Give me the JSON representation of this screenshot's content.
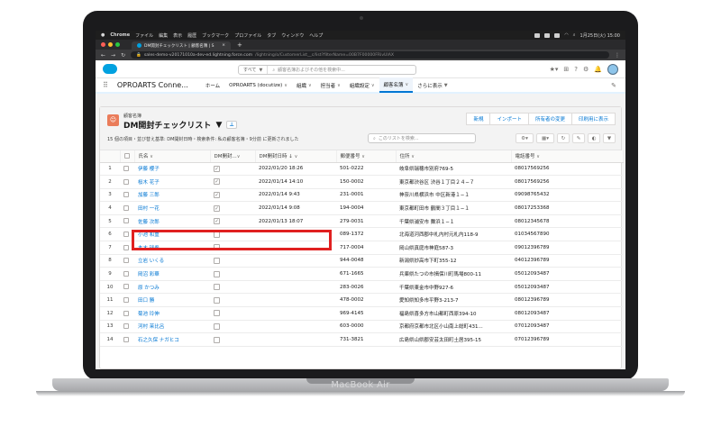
{
  "device": {
    "brand": "MacBook Air"
  },
  "mac_menu": {
    "items": [
      "Chrome",
      "ファイル",
      "編集",
      "表示",
      "履歴",
      "ブックマーク",
      "プロファイル",
      "タブ",
      "ウィンドウ",
      "ヘルプ"
    ],
    "clock": "1月25日(火) 15:00"
  },
  "browser": {
    "tab_title": "DM開封チェックリスト | 顧客名簿 | S",
    "url_host": "sales-demo-v20171010a-dev-ed.lightning.force.com",
    "url_path": "/lightning/o/CustomerList__c/list?filterName=00B7F00000FRivUIAX"
  },
  "sf_header": {
    "search_scope": "すべて",
    "search_placeholder": "顧客名簿およびその他を検索中..."
  },
  "nav": {
    "app_name": "OPROARTS Conne...",
    "items": [
      {
        "label": "ホーム"
      },
      {
        "label": "OPROARTS (docutize)"
      },
      {
        "label": "組織"
      },
      {
        "label": "担当者"
      },
      {
        "label": "組織設定"
      },
      {
        "label": "顧客名簿"
      },
      {
        "label": "さらに表示"
      }
    ]
  },
  "list_view": {
    "object_name": "顧客名簿",
    "title": "DM開封チェックリスト",
    "meta": "15 個の項目・並び替え基準: DM開封日時・検索条件: 私の顧客名簿・9分前 に更新されました",
    "buttons": [
      "新規",
      "インポート",
      "所有者の変更",
      "印刷用に表示"
    ],
    "search_placeholder": "このリストを検索...",
    "columns": [
      "氏名",
      "DM開封...",
      "DM開封日時 ↓",
      "郵便番号",
      "住所",
      "電話番号"
    ],
    "rows": [
      {
        "no": "1",
        "name": "伊藤 櫻子",
        "opened": true,
        "date": "2022/01/20 18:26",
        "zip": "501-0222",
        "address": "岐阜県瑞穂市別府769-5",
        "phone": "08017569256"
      },
      {
        "no": "2",
        "name": "桜木 花子",
        "opened": true,
        "date": "2022/01/14 14:10",
        "zip": "150-0002",
        "address": "東京都渋谷区 渋谷１丁目２４−７",
        "phone": "08017569256"
      },
      {
        "no": "3",
        "name": "加藤 三郎",
        "opened": true,
        "date": "2022/01/14 9:43",
        "zip": "231-0001",
        "address": "神奈川県横浜市 中区新港１−１",
        "phone": "09098765432"
      },
      {
        "no": "4",
        "name": "田村 一花",
        "opened": true,
        "date": "2022/01/14 9:08",
        "zip": "194-0004",
        "address": "東京都町田市 鶴間３丁目１−１",
        "phone": "08017253368"
      },
      {
        "no": "5",
        "name": "佐藤 次郎",
        "opened": true,
        "date": "2022/01/13 18:07",
        "zip": "279-0031",
        "address": "千葉県浦安市 舞浜１−１",
        "phone": "08012345678"
      },
      {
        "no": "6",
        "name": "小池 和重",
        "opened": false,
        "date": "",
        "zip": "089-1372",
        "address": "北海道河西郡中札内村元札内118-9",
        "phone": "01034567890"
      },
      {
        "no": "7",
        "name": "本木 瑞希",
        "opened": false,
        "date": "",
        "zip": "717-0004",
        "address": "岡山県真庭市神庭587-3",
        "phone": "09012396789"
      },
      {
        "no": "8",
        "name": "立岩 いくる",
        "opened": false,
        "date": "",
        "zip": "944-0048",
        "address": "新潟県妙高市下町355-12",
        "phone": "04012396789"
      },
      {
        "no": "9",
        "name": "岡沼 彩華",
        "opened": false,
        "date": "",
        "zip": "671-1665",
        "address": "兵庫県たつの市揖保川町馬場800-11",
        "phone": "05012093487"
      },
      {
        "no": "10",
        "name": "原 かつみ",
        "opened": false,
        "date": "",
        "zip": "283-0026",
        "address": "千葉県東金市中野927-6",
        "phone": "05012093487"
      },
      {
        "no": "11",
        "name": "田口 勝",
        "opened": false,
        "date": "",
        "zip": "478-0002",
        "address": "愛知県知多市平野3-213-7",
        "phone": "08012396789"
      },
      {
        "no": "12",
        "name": "菊池 玲伸",
        "opened": false,
        "date": "",
        "zip": "969-4145",
        "address": "福島県喜多方市山都町西原394-10",
        "phone": "08012093487"
      },
      {
        "no": "13",
        "name": "河村 茉比呂",
        "opened": false,
        "date": "",
        "zip": "603-0000",
        "address": "京都府京都市北区小山南上総町431...",
        "phone": "07012093487"
      },
      {
        "no": "14",
        "name": "石之久保 ナガヒコ",
        "opened": false,
        "date": "",
        "zip": "731-3821",
        "address": "広島県山県郡安芸太田町土居395-15",
        "phone": "07012396789"
      }
    ]
  },
  "colors": {
    "accent": "#0176d3",
    "highlight": "#e02020",
    "object_icon": "#ea7c5a"
  }
}
